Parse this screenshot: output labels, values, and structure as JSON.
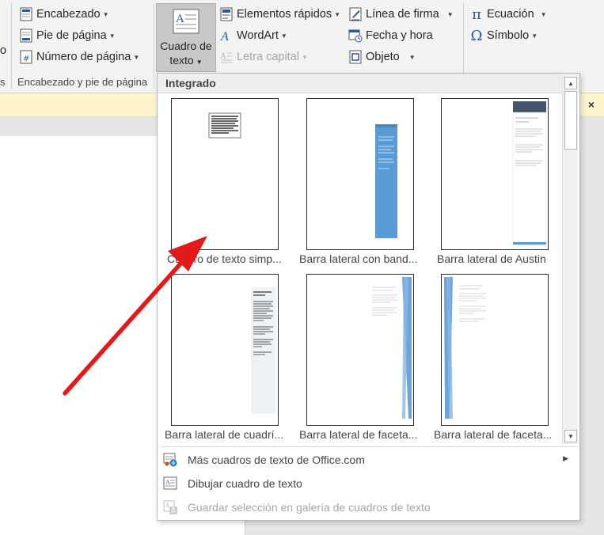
{
  "ribbon": {
    "left_group": {
      "buttons": [
        {
          "label": "Encabezado",
          "dropdown": true
        },
        {
          "label": "Pie de página",
          "dropdown": true
        },
        {
          "label": "Número de página",
          "dropdown": true
        }
      ],
      "group_label": "Encabezado y pie de página",
      "partial_left_text": "o",
      "partial_left_label": "s"
    },
    "text_group": {
      "textbox_button": {
        "label_line1": "Cuadro de",
        "label_line2": "texto"
      },
      "col2": [
        {
          "label": "Elementos rápidos",
          "dropdown": true,
          "disabled": false
        },
        {
          "label": "WordArt",
          "dropdown": true,
          "disabled": false
        },
        {
          "label": "Letra capital",
          "dropdown": true,
          "disabled": true
        }
      ],
      "col3": [
        {
          "label": "Línea de firma",
          "dropdown": true
        },
        {
          "label": "Fecha y hora",
          "dropdown": false
        },
        {
          "label": "Objeto",
          "dropdown": true
        }
      ]
    },
    "symbols_group": {
      "buttons": [
        {
          "label": "Ecuación",
          "dropdown": true
        },
        {
          "label": "Símbolo",
          "dropdown": true
        }
      ]
    }
  },
  "message_bar": {
    "close_glyph": "×"
  },
  "gallery": {
    "header": "Integrado",
    "items": [
      {
        "label": "Cuadro de texto simp...",
        "style": "simple"
      },
      {
        "label": "Barra lateral con band...",
        "style": "band"
      },
      {
        "label": "Barra lateral de Austin",
        "style": "austin"
      },
      {
        "label": "Barra lateral de cuadrí...",
        "style": "grid"
      },
      {
        "label": "Barra lateral de faceta...",
        "style": "facet-right"
      },
      {
        "label": "Barra lateral de faceta...",
        "style": "facet-left"
      }
    ],
    "menu": [
      {
        "label": "Más cuadros de texto de Office.com",
        "has_submenu": true,
        "disabled": false
      },
      {
        "label": "Dibujar cuadro de texto",
        "has_submenu": false,
        "disabled": false
      },
      {
        "label": "Guardar selección en galería de cuadros de texto",
        "has_submenu": false,
        "disabled": true
      }
    ],
    "scroll_up_glyph": "▲",
    "scroll_down_glyph": "▼",
    "submenu_glyph": "▶"
  },
  "colors": {
    "ribbon_bg": "#f3f3f3",
    "selected_button": "#c8c8c8",
    "message_bar": "#fff4ce",
    "icon_blue": "#2b579a",
    "sidebar_blue": "#5b9bd5",
    "austin_header": "#44546a",
    "arrow_red": "#e21a1a"
  },
  "icons": [
    "header-icon",
    "footer-icon",
    "page-number-icon",
    "textbox-icon",
    "quick-parts-icon",
    "wordart-icon",
    "drop-cap-icon",
    "signature-line-icon",
    "date-time-icon",
    "object-icon",
    "equation-icon",
    "symbol-icon",
    "office-com-icon",
    "draw-textbox-icon",
    "save-selection-icon"
  ]
}
